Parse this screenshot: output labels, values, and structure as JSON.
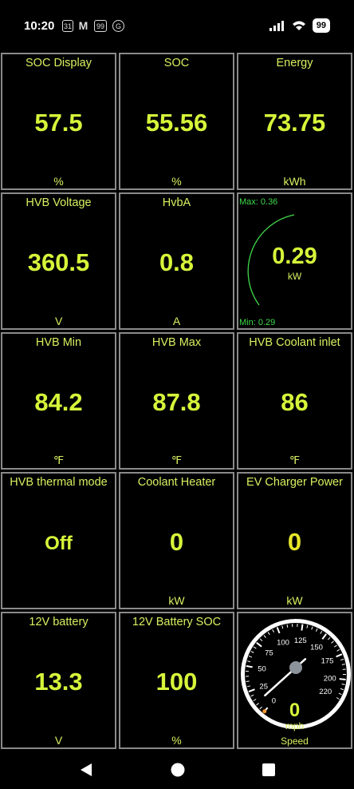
{
  "status": {
    "time": "10:20",
    "notif_icons": [
      "31",
      "M",
      "99",
      "G"
    ],
    "battery": "99"
  },
  "tiles": [
    {
      "label": "SOC Display",
      "value": "57.5",
      "unit": "%"
    },
    {
      "label": "SOC",
      "value": "55.56",
      "unit": "%"
    },
    {
      "label": "Energy",
      "value": "73.75",
      "unit": "kWh"
    },
    {
      "label": "HVB Voltage",
      "value": "360.5",
      "unit": "V"
    },
    {
      "label": "HvbA",
      "value": "0.8",
      "unit": "A"
    },
    {
      "label": "",
      "value": "",
      "unit": ""
    },
    {
      "label": "HVB Min",
      "value": "84.2",
      "unit": "℉"
    },
    {
      "label": "HVB Max",
      "value": "87.8",
      "unit": "℉"
    },
    {
      "label": "HVB Coolant inlet",
      "value": "86",
      "unit": "℉"
    },
    {
      "label": "HVB thermal mode",
      "value": "Off",
      "unit": ""
    },
    {
      "label": "Coolant Heater",
      "value": "0",
      "unit": "kW"
    },
    {
      "label": "EV Charger Power",
      "value": "0",
      "unit": "kW"
    },
    {
      "label": "12V battery",
      "value": "13.3",
      "unit": "V"
    },
    {
      "label": "12V Battery SOC",
      "value": "100",
      "unit": "%"
    }
  ],
  "power_gauge": {
    "max_label": "Max: 0.36",
    "min_label": "Min: 0.29",
    "value": "0.29",
    "unit": "kW"
  },
  "speed_gauge": {
    "ticks": [
      "0",
      "25",
      "50",
      "75",
      "100",
      "125",
      "150",
      "175",
      "200",
      "220"
    ],
    "value": "0",
    "unit": "mph",
    "label": "Speed",
    "needle_value": 0
  },
  "colors": {
    "value": "#d6f53a",
    "label": "#d6f060",
    "border": "#8a8a8a",
    "gauge_green": "#3fd84a"
  }
}
